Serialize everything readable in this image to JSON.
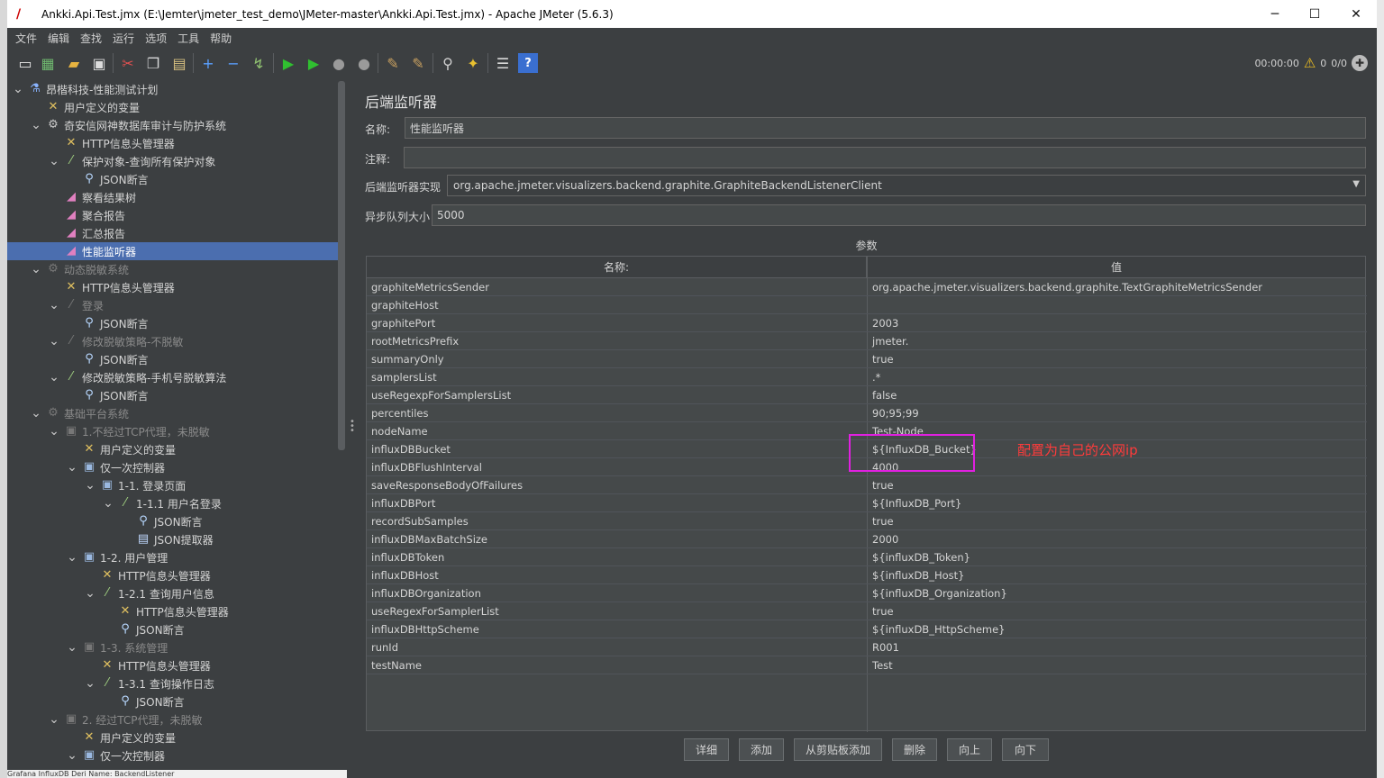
{
  "window": {
    "title": "Ankki.Api.Test.jmx (E:\\Jemter\\jmeter_test_demo\\JMeter-master\\Ankki.Api.Test.jmx) - Apache JMeter (5.6.3)",
    "app_icon": "jmeter-feather-icon",
    "minimize": "─",
    "maximize": "☐",
    "close": "✕"
  },
  "menu": [
    "文件",
    "编辑",
    "查找",
    "运行",
    "选项",
    "工具",
    "帮助"
  ],
  "toolbar": {
    "buttons": [
      {
        "name": "new-icon",
        "glyph": "▭",
        "color": "#e8e8e8"
      },
      {
        "name": "templates-icon",
        "glyph": "▦",
        "color": "#6fb86f"
      },
      {
        "name": "open-icon",
        "glyph": "▰",
        "color": "#e8b440"
      },
      {
        "name": "save-icon",
        "glyph": "▣",
        "color": "#dcdcdc"
      },
      {
        "name": "cut-icon",
        "glyph": "✂",
        "color": "#e05050"
      },
      {
        "name": "copy-icon",
        "glyph": "❐",
        "color": "#d8d8d8"
      },
      {
        "name": "paste-icon",
        "glyph": "▤",
        "color": "#d8c080"
      },
      {
        "name": "expand-icon",
        "glyph": "+",
        "color": "#5aa0ff"
      },
      {
        "name": "collapse-icon",
        "glyph": "−",
        "color": "#5aa0ff"
      },
      {
        "name": "toggle-icon",
        "glyph": "↯",
        "color": "#8fc070"
      },
      {
        "name": "start-icon",
        "glyph": "▶",
        "color": "#30c030"
      },
      {
        "name": "start-no-pause-icon",
        "glyph": "▶",
        "color": "#30c030"
      },
      {
        "name": "stop-icon",
        "glyph": "●",
        "color": "#9a9a9a"
      },
      {
        "name": "shutdown-icon",
        "glyph": "●",
        "color": "#9a9a9a"
      },
      {
        "name": "clear-icon",
        "glyph": "✎",
        "color": "#c8a060"
      },
      {
        "name": "clear-all-icon",
        "glyph": "✎",
        "color": "#c8a060"
      },
      {
        "name": "search-icon",
        "glyph": "⚲",
        "color": "#d0d0d0"
      },
      {
        "name": "reset-search-icon",
        "glyph": "✦",
        "color": "#e8c030"
      },
      {
        "name": "function-helper-icon",
        "glyph": "☰",
        "color": "#d8d8d8"
      },
      {
        "name": "help-icon",
        "glyph": "?",
        "color": "#ffffff"
      }
    ],
    "elapsed": "00:00:00",
    "warnings": "0",
    "threads": "0/0",
    "warning_icon": "warning-icon",
    "remote_icon": "remote-icon"
  },
  "tree": [
    {
      "label": "昂楷科技-性能测试计划",
      "level": 0,
      "toggle": "v",
      "icon": "flask-icon",
      "disabled": false
    },
    {
      "label": "用户定义的变量",
      "level": 1,
      "toggle": "",
      "icon": "wrench-icon",
      "disabled": false
    },
    {
      "label": "奇安信网神数据库审计与防护系统",
      "level": 1,
      "toggle": "v",
      "icon": "gear-icon",
      "disabled": false
    },
    {
      "label": "HTTP信息头管理器",
      "level": 2,
      "toggle": "",
      "icon": "wrench-icon",
      "disabled": false
    },
    {
      "label": "保护对象-查询所有保护对象",
      "level": 2,
      "toggle": "v",
      "icon": "pipette-icon",
      "disabled": false
    },
    {
      "label": "JSON断言",
      "level": 3,
      "toggle": "",
      "icon": "magnifier-icon",
      "disabled": false
    },
    {
      "label": "察看结果树",
      "level": 2,
      "toggle": "",
      "icon": "graph-icon",
      "disabled": false
    },
    {
      "label": "聚合报告",
      "level": 2,
      "toggle": "",
      "icon": "graph-icon",
      "disabled": false
    },
    {
      "label": "汇总报告",
      "level": 2,
      "toggle": "",
      "icon": "graph-icon",
      "disabled": false
    },
    {
      "label": "性能监听器",
      "level": 2,
      "toggle": "",
      "icon": "graph-icon",
      "disabled": false,
      "selected": true
    },
    {
      "label": "动态脱敏系统",
      "level": 1,
      "toggle": "v",
      "icon": "gear-icon",
      "disabled": true
    },
    {
      "label": "HTTP信息头管理器",
      "level": 2,
      "toggle": "",
      "icon": "wrench-icon",
      "disabled": false
    },
    {
      "label": "登录",
      "level": 2,
      "toggle": "v",
      "icon": "pipette-icon",
      "disabled": true
    },
    {
      "label": "JSON断言",
      "level": 3,
      "toggle": "",
      "icon": "magnifier-icon",
      "disabled": false
    },
    {
      "label": "修改脱敏策略-不脱敏",
      "level": 2,
      "toggle": "v",
      "icon": "pipette-icon",
      "disabled": true
    },
    {
      "label": "JSON断言",
      "level": 3,
      "toggle": "",
      "icon": "magnifier-icon",
      "disabled": false
    },
    {
      "label": "修改脱敏策略-手机号脱敏算法",
      "level": 2,
      "toggle": "v",
      "icon": "pipette-icon",
      "disabled": false
    },
    {
      "label": "JSON断言",
      "level": 3,
      "toggle": "",
      "icon": "magnifier-icon",
      "disabled": false
    },
    {
      "label": "基础平台系统",
      "level": 1,
      "toggle": "v",
      "icon": "gear-icon",
      "disabled": true
    },
    {
      "label": "1.不经过TCP代理，未脱敏",
      "level": 2,
      "toggle": "v",
      "icon": "controller-icon",
      "disabled": true
    },
    {
      "label": "用户定义的变量",
      "level": 3,
      "toggle": "",
      "icon": "wrench-icon",
      "disabled": false
    },
    {
      "label": "仅一次控制器",
      "level": 3,
      "toggle": "v",
      "icon": "controller-icon",
      "disabled": false
    },
    {
      "label": "1-1. 登录页面",
      "level": 4,
      "toggle": "v",
      "icon": "controller-icon",
      "disabled": false
    },
    {
      "label": "1-1.1 用户名登录",
      "level": 5,
      "toggle": "v",
      "icon": "pipette-icon",
      "disabled": false
    },
    {
      "label": "JSON断言",
      "level": 6,
      "toggle": "",
      "icon": "magnifier-icon",
      "disabled": false
    },
    {
      "label": "JSON提取器",
      "level": 6,
      "toggle": "",
      "icon": "extractor-icon",
      "disabled": false
    },
    {
      "label": "1-2. 用户管理",
      "level": 3,
      "toggle": "v",
      "icon": "controller-icon",
      "disabled": false
    },
    {
      "label": "HTTP信息头管理器",
      "level": 4,
      "toggle": "",
      "icon": "wrench-icon",
      "disabled": false
    },
    {
      "label": "1-2.1 查询用户信息",
      "level": 4,
      "toggle": "v",
      "icon": "pipette-icon",
      "disabled": false
    },
    {
      "label": "HTTP信息头管理器",
      "level": 5,
      "toggle": "",
      "icon": "wrench-icon",
      "disabled": false
    },
    {
      "label": "JSON断言",
      "level": 5,
      "toggle": "",
      "icon": "magnifier-icon",
      "disabled": false
    },
    {
      "label": "1-3. 系统管理",
      "level": 3,
      "toggle": "v",
      "icon": "controller-icon",
      "disabled": true
    },
    {
      "label": "HTTP信息头管理器",
      "level": 4,
      "toggle": "",
      "icon": "wrench-icon",
      "disabled": false
    },
    {
      "label": "1-3.1 查询操作日志",
      "level": 4,
      "toggle": "v",
      "icon": "pipette-icon",
      "disabled": false
    },
    {
      "label": "JSON断言",
      "level": 5,
      "toggle": "",
      "icon": "magnifier-icon",
      "disabled": false
    },
    {
      "label": "2. 经过TCP代理，未脱敏",
      "level": 2,
      "toggle": "v",
      "icon": "controller-icon",
      "disabled": true
    },
    {
      "label": "用户定义的变量",
      "level": 3,
      "toggle": "",
      "icon": "wrench-icon",
      "disabled": false
    },
    {
      "label": "仅一次控制器",
      "level": 3,
      "toggle": "v",
      "icon": "controller-icon",
      "disabled": false
    }
  ],
  "bottom_strip": "Grafana  InfluxDB  Deri    Name: BackendListener",
  "editor": {
    "title": "后端监听器",
    "name_label": "名称:",
    "name_value": "性能监听器",
    "comment_label": "注释:",
    "comment_value": "",
    "impl_label": "后端监听器实现",
    "impl_value": "org.apache.jmeter.visualizers.backend.graphite.GraphiteBackendListenerClient",
    "queue_label": "异步队列大小",
    "queue_value": "5000",
    "params_caption": "参数",
    "col_name": "名称:",
    "col_value": "值",
    "params": [
      {
        "name": "graphiteMetricsSender",
        "value": "org.apache.jmeter.visualizers.backend.graphite.TextGraphiteMetricsSender"
      },
      {
        "name": "graphiteHost",
        "value": ""
      },
      {
        "name": "graphitePort",
        "value": "2003"
      },
      {
        "name": "rootMetricsPrefix",
        "value": "jmeter."
      },
      {
        "name": "summaryOnly",
        "value": "true"
      },
      {
        "name": "samplersList",
        "value": ".*"
      },
      {
        "name": "useRegexpForSamplersList",
        "value": "false"
      },
      {
        "name": "percentiles",
        "value": "90;95;99"
      },
      {
        "name": "nodeName",
        "value": "Test-Node"
      },
      {
        "name": "influxDBBucket",
        "value": "${InfluxDB_Bucket}"
      },
      {
        "name": "influxDBFlushInterval",
        "value": "4000"
      },
      {
        "name": "saveResponseBodyOfFailures",
        "value": "true"
      },
      {
        "name": "influxDBPort",
        "value": "${InfluxDB_Port}"
      },
      {
        "name": "recordSubSamples",
        "value": "true"
      },
      {
        "name": "influxDBMaxBatchSize",
        "value": "2000"
      },
      {
        "name": "influxDBToken",
        "value": "${influxDB_Token}"
      },
      {
        "name": "influxDBHost",
        "value": "${influxDB_Host}"
      },
      {
        "name": "influxDBOrganization",
        "value": "${influxDB_Organization}"
      },
      {
        "name": "useRegexForSamplerList",
        "value": "true"
      },
      {
        "name": "influxDBHttpScheme",
        "value": "${influxDB_HttpScheme}"
      },
      {
        "name": "runId",
        "value": "R001"
      },
      {
        "name": "testName",
        "value": "Test"
      }
    ],
    "annotation": "配置为自己的公网ip",
    "annotation_color": "#ff3b3b",
    "highlight_color": "#e020e0",
    "buttons": [
      "详细",
      "添加",
      "从剪贴板添加",
      "删除",
      "向上",
      "向下"
    ]
  },
  "colors": {
    "background": "#3c3f41",
    "selection": "#4b6eaf",
    "text": "#d4d4d4"
  }
}
